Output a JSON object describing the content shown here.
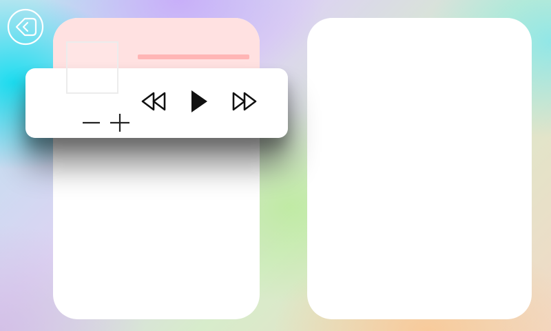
{
  "icons": {
    "back": "back-arrow-circle-icon",
    "zoom_out": "minus-icon",
    "zoom_in": "plus-icon",
    "rewind": "rewind-icon",
    "play": "play-icon",
    "fast_forward": "fast-forward-icon"
  },
  "colors": {
    "panel_header": "#ffe1e1",
    "title_placeholder": "#ffb5b5"
  }
}
